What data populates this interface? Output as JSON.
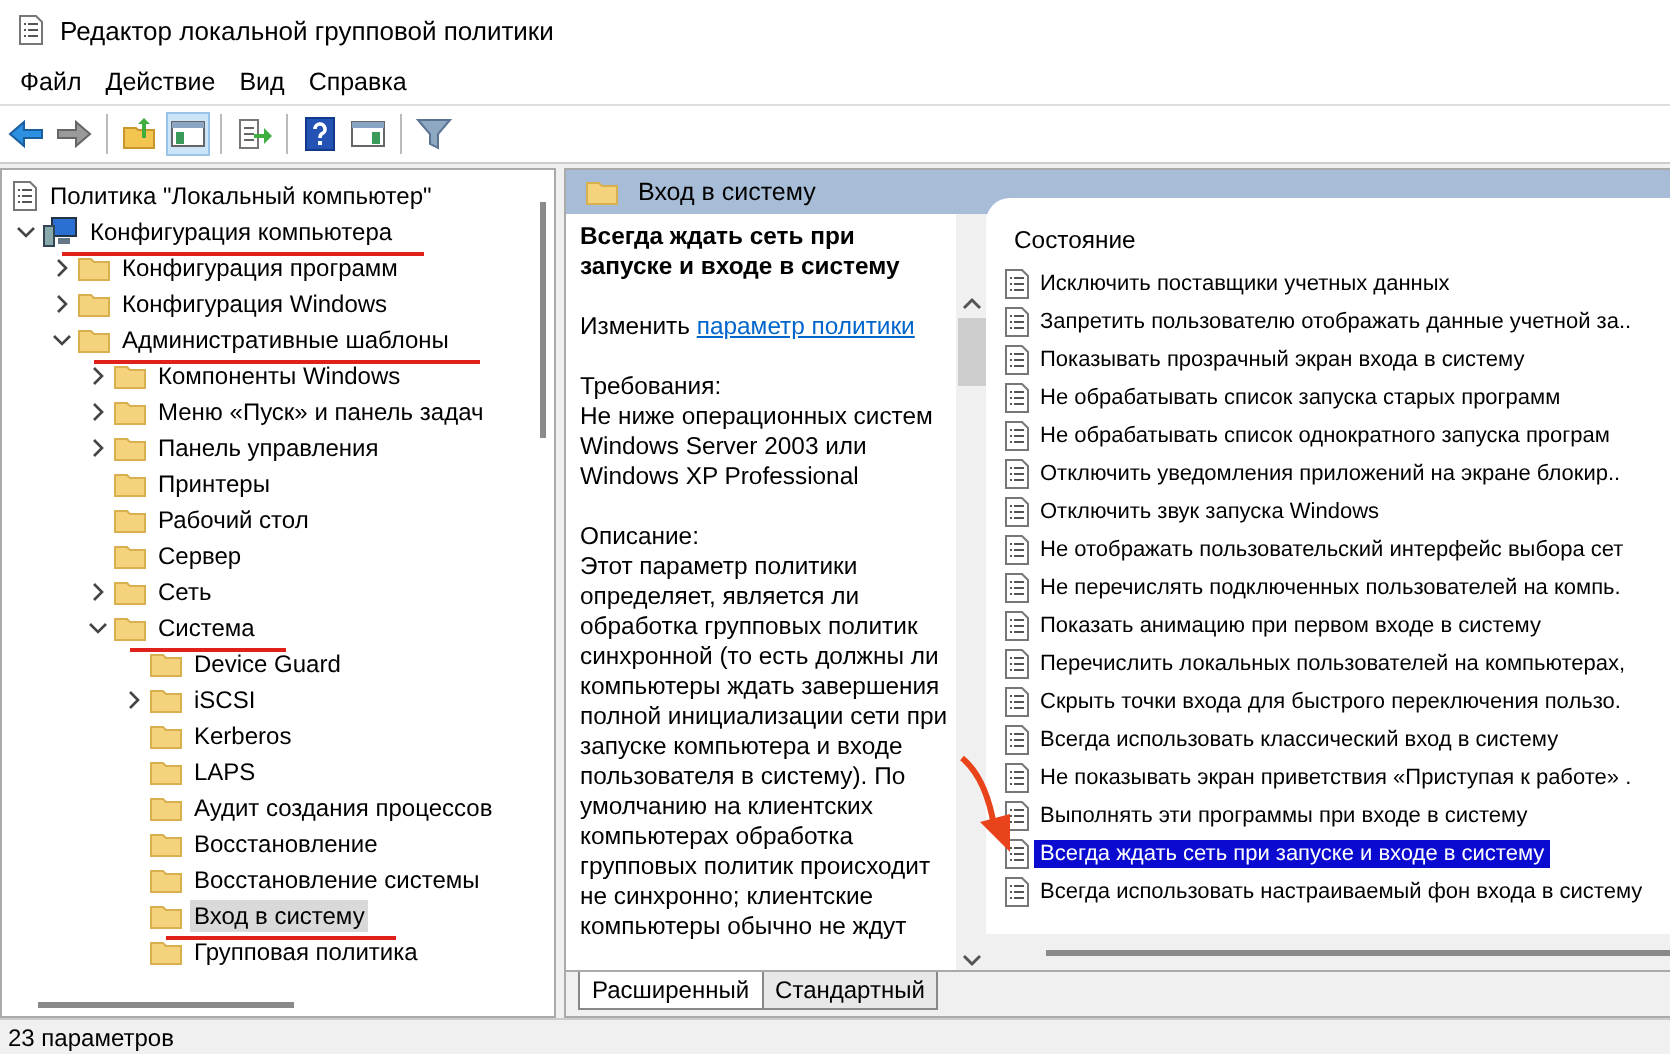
{
  "window": {
    "title": "Редактор локальной групповой политики"
  },
  "menu": [
    "Файл",
    "Действие",
    "Вид",
    "Справка"
  ],
  "toolbar": [
    {
      "kind": "back",
      "pressed": false
    },
    {
      "kind": "forward",
      "pressed": false
    },
    {
      "kind": "separator"
    },
    {
      "kind": "up",
      "pressed": false
    },
    {
      "kind": "tree-toggle",
      "pressed": true
    },
    {
      "kind": "separator"
    },
    {
      "kind": "export",
      "pressed": false
    },
    {
      "kind": "separator"
    },
    {
      "kind": "help",
      "pressed": false
    },
    {
      "kind": "pane-toggle",
      "pressed": false
    },
    {
      "kind": "separator"
    },
    {
      "kind": "filter",
      "pressed": false
    }
  ],
  "tree": {
    "label": "Политика \"Локальный компьютер\"",
    "kind": "policy",
    "selected": false,
    "annotated": false,
    "children": [
      {
        "label": "Конфигурация компьютера",
        "kind": "computer",
        "expanded": true,
        "selected": false,
        "annotated": true,
        "children": [
          {
            "label": "Конфигурация программ",
            "kind": "folder",
            "expanded": false,
            "selected": false,
            "annotated": false
          },
          {
            "label": "Конфигурация Windows",
            "kind": "folder",
            "expanded": false,
            "selected": false,
            "annotated": false
          },
          {
            "label": "Административные шаблоны",
            "kind": "folder",
            "expanded": true,
            "selected": false,
            "annotated": true,
            "children": [
              {
                "label": "Компоненты Windows",
                "kind": "folder",
                "expanded": false,
                "selected": false,
                "annotated": false
              },
              {
                "label": "Меню «Пуск» и панель задач",
                "kind": "folder",
                "expanded": false,
                "selected": false,
                "annotated": false
              },
              {
                "label": "Панель управления",
                "kind": "folder",
                "expanded": false,
                "selected": false,
                "annotated": false
              },
              {
                "label": "Принтеры",
                "kind": "folder",
                "selected": false,
                "annotated": false
              },
              {
                "label": "Рабочий стол",
                "kind": "folder",
                "selected": false,
                "annotated": false
              },
              {
                "label": "Сервер",
                "kind": "folder",
                "selected": false,
                "annotated": false
              },
              {
                "label": "Сеть",
                "kind": "folder",
                "expanded": false,
                "selected": false,
                "annotated": false
              },
              {
                "label": "Система",
                "kind": "folder",
                "expanded": true,
                "selected": false,
                "annotated": true,
                "children": [
                  {
                    "label": "Device Guard",
                    "kind": "folder",
                    "selected": false,
                    "annotated": false
                  },
                  {
                    "label": "iSCSI",
                    "kind": "folder",
                    "expanded": false,
                    "selected": false,
                    "annotated": false
                  },
                  {
                    "label": "Kerberos",
                    "kind": "folder",
                    "selected": false,
                    "annotated": false
                  },
                  {
                    "label": "LAPS",
                    "kind": "folder",
                    "selected": false,
                    "annotated": false
                  },
                  {
                    "label": "Аудит создания процессов",
                    "kind": "folder",
                    "selected": false,
                    "annotated": false
                  },
                  {
                    "label": "Восстановление",
                    "kind": "folder",
                    "selected": false,
                    "annotated": false
                  },
                  {
                    "label": "Восстановление системы",
                    "kind": "folder",
                    "selected": false,
                    "annotated": false
                  },
                  {
                    "label": "Вход в систему",
                    "kind": "folder",
                    "selected": true,
                    "annotated": true
                  },
                  {
                    "label": "Групповая политика",
                    "kind": "folder",
                    "selected": false,
                    "annotated": false
                  }
                ]
              }
            ]
          }
        ]
      }
    ]
  },
  "details": {
    "header": "Вход в систему",
    "title": "Всегда ждать сеть при запуске и входе в систему",
    "edit_prefix": "Изменить",
    "edit_link": "параметр политики",
    "requirements_label": "Требования:",
    "requirements": "Не ниже операционных систем Windows Server 2003 или Windows XP Professional",
    "description_label": "Описание:",
    "description": "Этот параметр политики определяет, является ли обработка групповых политик синхронной (то есть должны ли компьютеры ждать завершения полной инициализации сети при запуске компьютера и входе пользователя в систему). По умолчанию на клиентских компьютерах обработка групповых политик происходит не синхронно; клиентские компьютеры обычно не ждут"
  },
  "list": {
    "column": "Состояние",
    "items": [
      {
        "label": "Исключить поставщики учетных данных",
        "selected": false
      },
      {
        "label": "Запретить пользователю отображать данные учетной за..",
        "selected": false
      },
      {
        "label": "Показывать прозрачный экран входа в систему",
        "selected": false
      },
      {
        "label": "Не обрабатывать список запуска старых программ",
        "selected": false
      },
      {
        "label": "Не обрабатывать список однократного запуска програм",
        "selected": false
      },
      {
        "label": "Отключить уведомления приложений на экране блокир..",
        "selected": false
      },
      {
        "label": "Отключить звук запуска Windows",
        "selected": false
      },
      {
        "label": "Не отображать пользовательский интерфейс выбора сет",
        "selected": false
      },
      {
        "label": "Не перечислять подключенных пользователей на компь.",
        "selected": false
      },
      {
        "label": "Показать анимацию при первом входе в систему",
        "selected": false
      },
      {
        "label": "Перечислить локальных пользователей на компьютерах,",
        "selected": false
      },
      {
        "label": "Скрыть точки входа для быстрого переключения пользо.",
        "selected": false
      },
      {
        "label": "Всегда использовать классический вход в систему",
        "selected": false
      },
      {
        "label": "Не показывать экран приветствия «Приступая к работе» .",
        "selected": false
      },
      {
        "label": "Выполнять эти программы при входе в систему",
        "selected": false
      },
      {
        "label": "Всегда ждать сеть при запуске и входе в систему",
        "selected": true
      },
      {
        "label": "Всегда использовать настраиваемый фон входа в систему",
        "selected": false
      }
    ]
  },
  "tabs": [
    {
      "label": "Расширенный",
      "selected": true
    },
    {
      "label": "Стандартный",
      "selected": false
    }
  ],
  "status_bar": "23 параметров"
}
